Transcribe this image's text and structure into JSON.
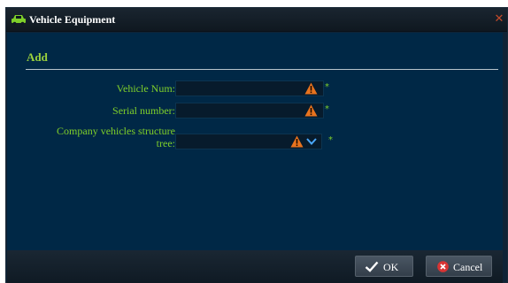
{
  "dialog": {
    "title": "Vehicle Equipment",
    "section_title": "Add"
  },
  "form": {
    "vehicle_num": {
      "label": "Vehicle Num:",
      "value": "",
      "required_mark": "*"
    },
    "serial_number": {
      "label": "Serial number:",
      "value": "",
      "required_mark": "*"
    },
    "structure_tree": {
      "label_line1": "Company vehicles structure",
      "label_line2": "tree:",
      "value": "",
      "required_mark": "*"
    }
  },
  "footer": {
    "ok_label": "OK",
    "cancel_label": "Cancel"
  },
  "colors": {
    "accent_green": "#7fcf2a",
    "warning_orange": "#e8731e",
    "cancel_red": "#d83434",
    "content_bg": "#002846"
  },
  "icons": {
    "title": "car-icon",
    "warning": "warning-icon",
    "dropdown": "chevron-down-icon",
    "ok": "check-icon",
    "cancel": "cancel-icon",
    "close": "close-icon"
  }
}
